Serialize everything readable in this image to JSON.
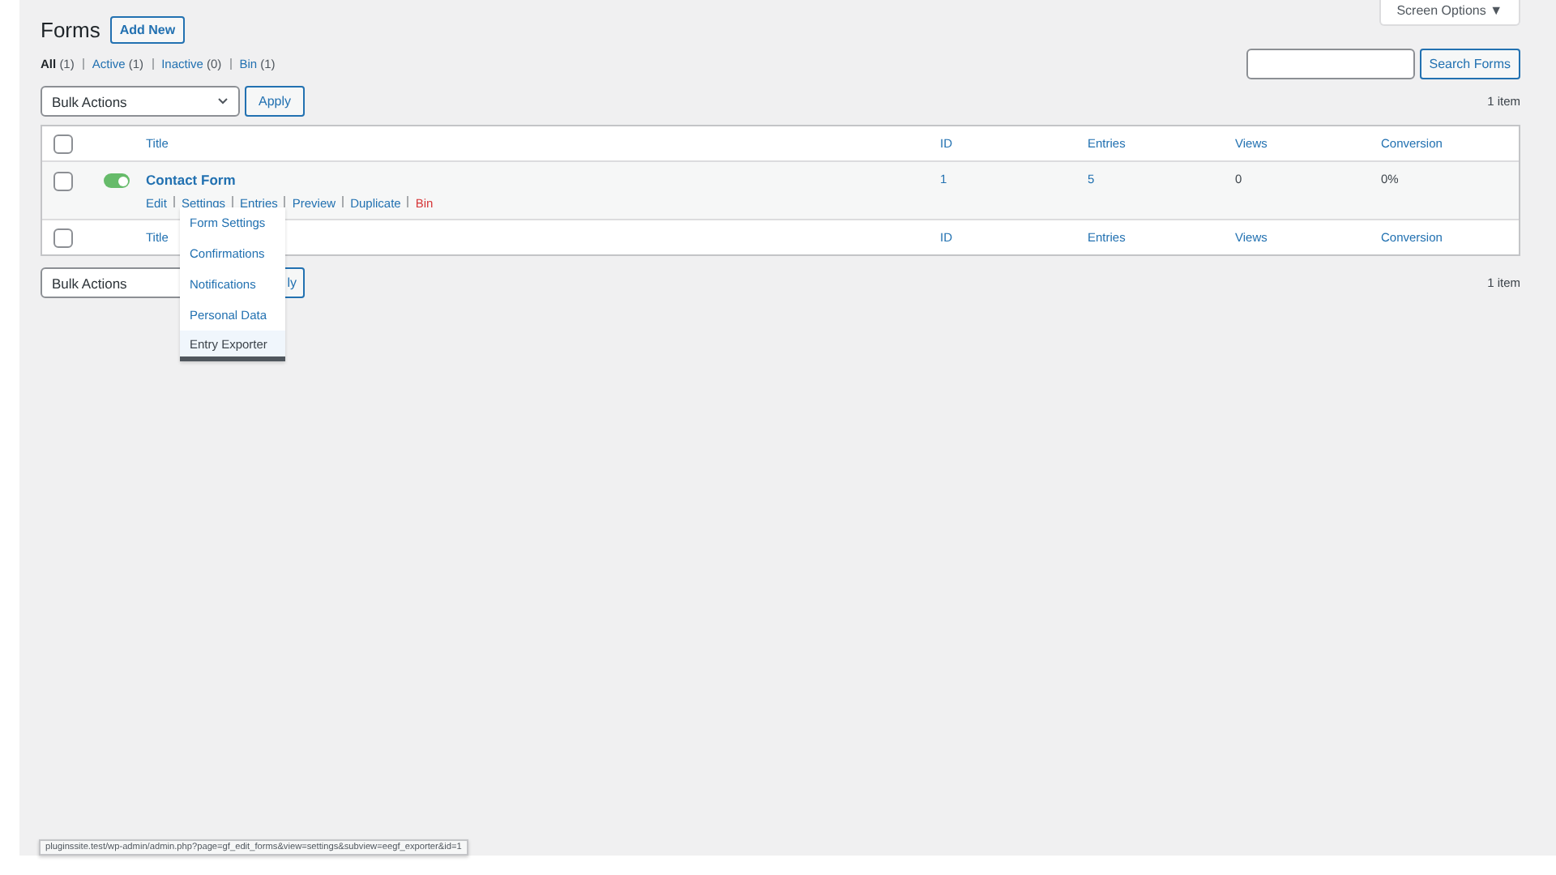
{
  "screen_options": "Screen Options ▼",
  "title": "Forms",
  "add_new": "Add New",
  "filters": [
    {
      "label": "All",
      "count": "(1)",
      "selected": true
    },
    {
      "label": "Active",
      "count": "(1)",
      "selected": false
    },
    {
      "label": "Inactive",
      "count": "(0)",
      "selected": false
    },
    {
      "label": "Bin",
      "count": "(1)",
      "selected": false
    }
  ],
  "search": {
    "button": "Search Forms"
  },
  "top_bulk": {
    "select": "Bulk Actions",
    "apply": "Apply",
    "count": "1 item"
  },
  "header_checked": false,
  "columns": [
    "Title",
    "ID",
    "Entries",
    "Views",
    "Conversion"
  ],
  "rows": [
    {
      "title": "Contact Form",
      "checked": false,
      "active": true,
      "id": "1",
      "entries": "5",
      "views": "0",
      "conversion": "0%",
      "actions": [
        {
          "label": "Edit",
          "kind": "link"
        },
        {
          "label": "Settings",
          "kind": "link"
        },
        {
          "label": "Entries",
          "kind": "link"
        },
        {
          "label": "Preview",
          "kind": "link"
        },
        {
          "label": "Duplicate",
          "kind": "link"
        },
        {
          "label": "Bin",
          "kind": "delete"
        }
      ]
    }
  ],
  "footer_checked": false,
  "footer_columns": [
    "Title",
    "ID",
    "Entries",
    "Views",
    "Conversion"
  ],
  "bottom_bulk": {
    "select": "Bulk Actions",
    "apply": "ly",
    "count": "1 item"
  },
  "settings_menu": [
    {
      "label": "Form Settings",
      "selected": false
    },
    {
      "label": "Confirmations",
      "selected": false
    },
    {
      "label": "Notifications",
      "selected": false
    },
    {
      "label": "Personal Data",
      "selected": false
    },
    {
      "label": "Entry Exporter",
      "selected": true
    }
  ],
  "status_url": "pluginssite.test/wp-admin/admin.php?page=gf_edit_forms&view=settings&subview=eegf_exporter&id=1"
}
